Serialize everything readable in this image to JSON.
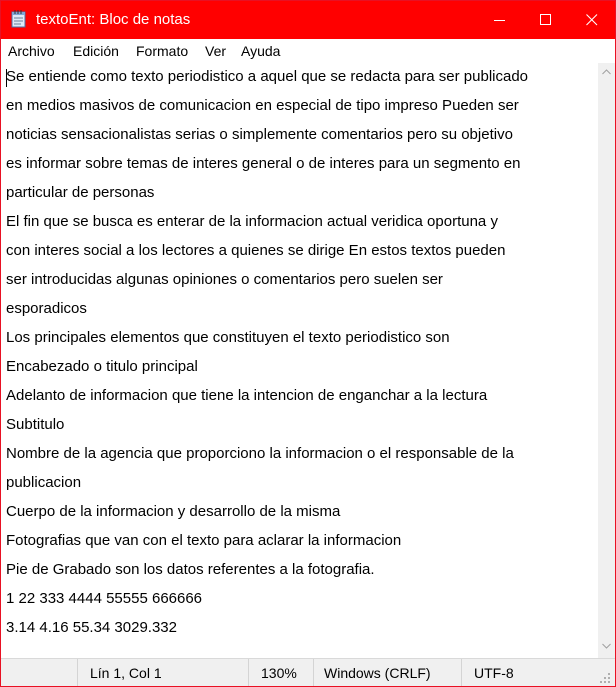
{
  "window": {
    "title": "textoEnt: Bloc de notas",
    "app_icon": "notepad-icon",
    "title_bar_color": "#ff0000"
  },
  "menu": [
    "Archivo",
    "Edición",
    "Formato",
    "Ver",
    "Ayuda"
  ],
  "editor": {
    "lines": [
      "Se entiende como texto periodistico a aquel que se redacta para ser publicado",
      "en medios masivos de comunicacion en especial de tipo impreso Pueden ser",
      "noticias sensacionalistas serias o simplemente comentarios pero su objetivo",
      "es informar sobre temas de interes general o de interes para un segmento en",
      "particular de personas",
      "El fin que se busca es enterar de la informacion actual veridica oportuna y",
      "con interes social a los lectores a quienes se dirige En estos textos pueden",
      "ser introducidas algunas opiniones o comentarios pero suelen ser",
      "esporadicos",
      "Los principales elementos que constituyen el texto periodistico son",
      "Encabezado o titulo principal",
      "Adelanto de informacion que tiene la intencion de enganchar a la lectura",
      "Subtitulo",
      "Nombre de la agencia que proporciono la informacion o el responsable de la",
      "publicacion",
      "Cuerpo de la informacion y desarrollo de la misma",
      "Fotografias que van con el texto para aclarar la informacion",
      "Pie de Grabado son los datos referentes a la fotografia.",
      "1 22 333 4444 55555 666666",
      "3.14 4.16 55.34 3029.332"
    ]
  },
  "status": {
    "position": "Lín 1, Col 1",
    "zoom": "130%",
    "line_ending": "Windows (CRLF)",
    "encoding": "UTF-8"
  }
}
